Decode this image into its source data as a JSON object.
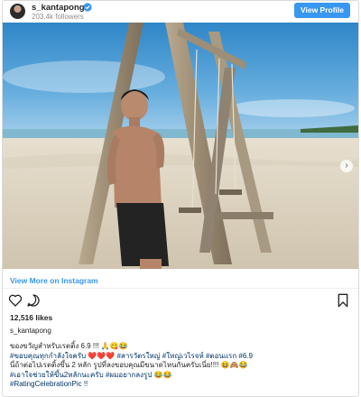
{
  "header": {
    "username": "s_kantapong",
    "followers": "203.4k followers",
    "view_profile_label": "View Profile",
    "verified_color": "#3897f0"
  },
  "post": {
    "view_more_label": "View More on Instagram",
    "likes": "12,516 likes",
    "author": "s_kantapong",
    "caption_lines": [
      "ของขวัญสำหรับเรตติ้ง 6.9 !!! 🙏😋😂",
      "#ขอบคุณทุกกำลังใจครับ ❤️❤️❤️ #สารวัตรใหญ่ #ใหญ่เวไรจห์ #ตอนแรก #6.9",
      "นี่ถ้าต่อไปเรตติ้งขึ้น 2 หลัก รูปที่ลงขอบคุณมีขนาดไหนกันครับเนี่ย!!!! 😆🙈😂",
      "#เอาใจช่วยให้ขึ้น2หลักนะครับ #ผมอยากลงรูป 😂😂",
      "#RatingCelebrationPic !!"
    ]
  },
  "icons": {
    "verified": "verified-badge-icon",
    "heart": "heart-icon",
    "comment": "comment-icon",
    "bookmark": "bookmark-icon",
    "next": "chevron-right-icon"
  },
  "colors": {
    "accent": "#3897f0",
    "hashtag": "#003569"
  }
}
